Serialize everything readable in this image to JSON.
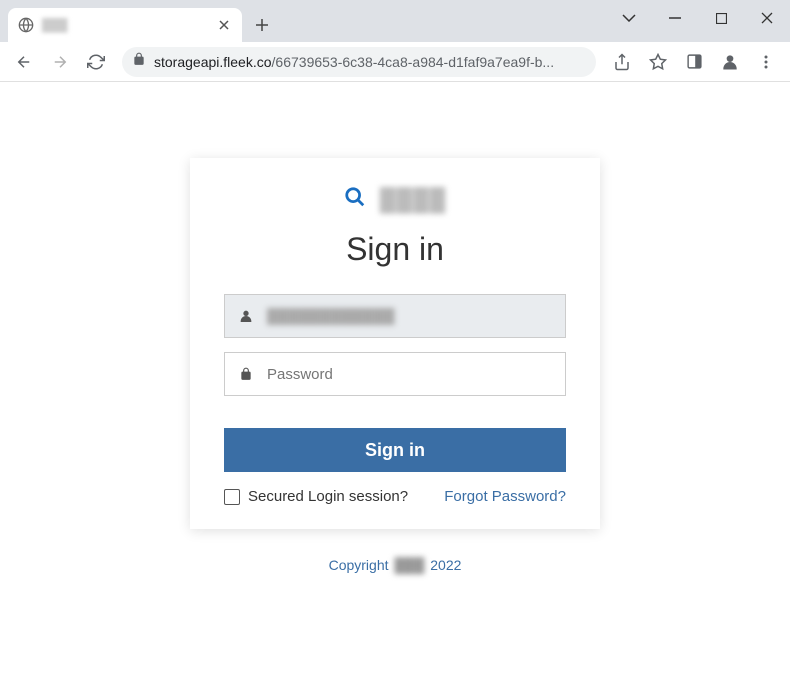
{
  "window": {
    "tab_title": "███"
  },
  "toolbar": {
    "url_domain": "storageapi.fleek.co",
    "url_path": "/66739653-6c38-4ca8-a984-d1faf9a7ea9f-b..."
  },
  "page": {
    "brand_name": "████",
    "signin_title": "Sign in",
    "email_value": "████████████",
    "password_placeholder": "Password",
    "signin_button": "Sign in",
    "secured_label": "Secured Login session?",
    "forgot_link": "Forgot Password?",
    "copyright_prefix": "Copyright",
    "copyright_brand": "███",
    "copyright_year": "2022"
  }
}
